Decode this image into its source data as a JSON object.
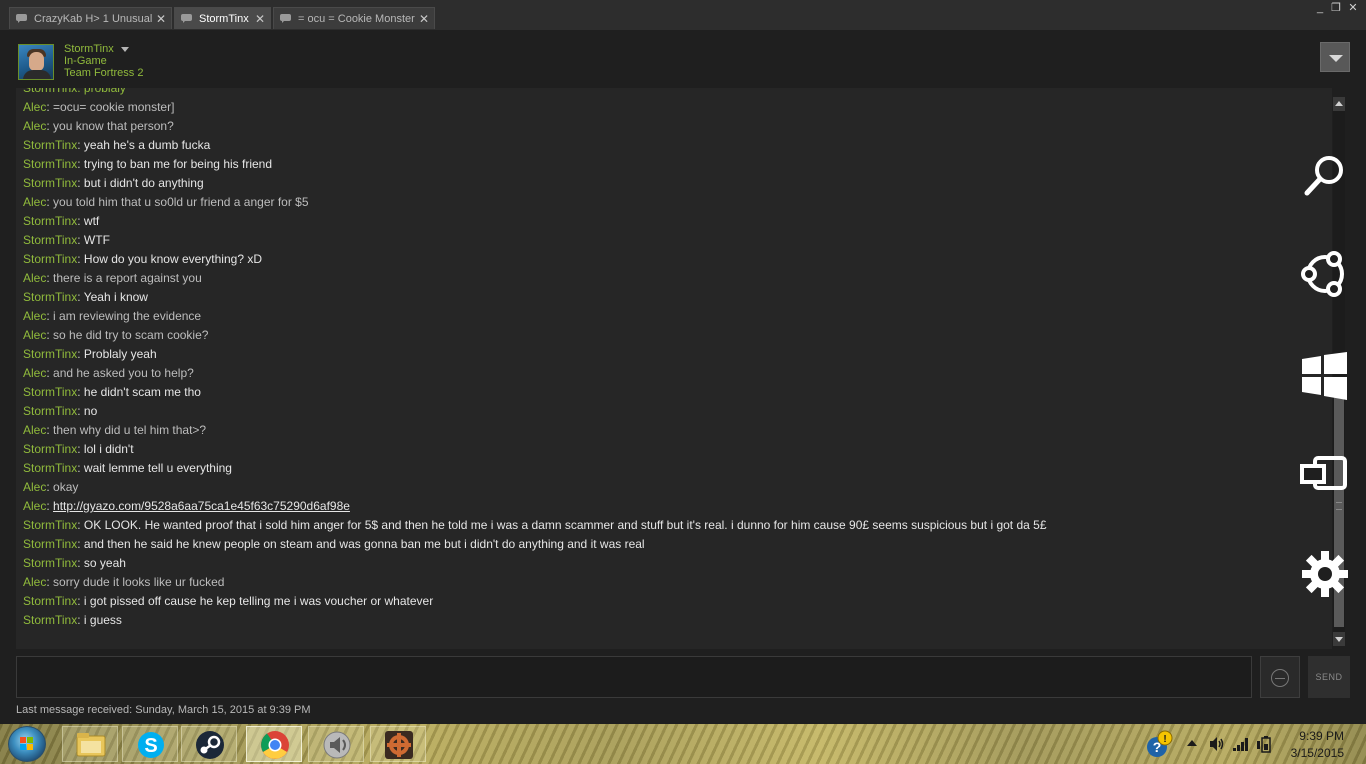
{
  "tabs": [
    {
      "label": "CrazyKab H> 1 Unusual",
      "active": false
    },
    {
      "label": "StormTinx",
      "active": true
    },
    {
      "label": "= ocu = Cookie Monster",
      "active": false
    }
  ],
  "window_controls": {
    "minimize": "_",
    "maximize": "❐"
  },
  "friend": {
    "name": "StormTinx",
    "status": "In-Game",
    "game": "Team Fortress 2"
  },
  "chat": {
    "partial_top_line": "StormTinx: problaly",
    "messages": [
      {
        "sender": "Alec",
        "text": "=ocu= cookie monster]"
      },
      {
        "sender": "Alec",
        "text": "you know that person?"
      },
      {
        "sender": "StormTinx",
        "text": "yeah he's a dumb fucka"
      },
      {
        "sender": "StormTinx",
        "text": "trying to ban me for being his friend"
      },
      {
        "sender": "StormTinx",
        "text": "but i didn't do anything"
      },
      {
        "sender": "Alec",
        "text": "you told him that u so0ld ur friend a anger for $5"
      },
      {
        "sender": "StormTinx",
        "text": "wtf"
      },
      {
        "sender": "StormTinx",
        "text": "WTF"
      },
      {
        "sender": "StormTinx",
        "text": "How do you know everything? xD"
      },
      {
        "sender": "Alec",
        "text": "there is a report against you"
      },
      {
        "sender": "StormTinx",
        "text": "Yeah i know"
      },
      {
        "sender": "Alec",
        "text": "i am reviewing the evidence"
      },
      {
        "sender": "Alec",
        "text": "so he did try to scam cookie?"
      },
      {
        "sender": "StormTinx",
        "text": "Problaly yeah"
      },
      {
        "sender": "Alec",
        "text": "and he asked you to help?"
      },
      {
        "sender": "StormTinx",
        "text": "he didn't scam me tho"
      },
      {
        "sender": "StormTinx",
        "text": "no"
      },
      {
        "sender": "Alec",
        "text": "then why did u tel him that>?"
      },
      {
        "sender": "StormTinx",
        "text": "lol i didn't"
      },
      {
        "sender": "StormTinx",
        "text": "wait lemme tell u everything"
      },
      {
        "sender": "Alec",
        "text": "okay"
      },
      {
        "sender": "Alec",
        "text": "http://gyazo.com/9528a6aa75ca1e45f63c75290d6af98e",
        "link": true
      },
      {
        "sender": "StormTinx",
        "text": "OK LOOK. He wanted proof that i sold him anger for 5$ and then he told me i was a damn scammer and stuff but it's real. i dunno for him cause 90£ seems suspicious but i got da 5£"
      },
      {
        "sender": "StormTinx",
        "text": "and then he said he knew people on steam and was gonna ban me but i didn't do anything and it was real"
      },
      {
        "sender": "StormTinx",
        "text": "so yeah"
      },
      {
        "sender": "Alec",
        "text": "sorry dude it looks like ur fucked"
      },
      {
        "sender": "StormTinx",
        "text": "i got pissed off cause he kep telling me i was voucher or whatever"
      },
      {
        "sender": "StormTinx",
        "text": "i guess"
      }
    ]
  },
  "charms": [
    "search-icon",
    "share-icon",
    "start-icon",
    "devices-icon",
    "settings-icon"
  ],
  "input": {
    "value": "",
    "placeholder": ""
  },
  "send_label": "SEND",
  "last_received": "Last message received: Sunday, March 15, 2015 at 9:39 PM",
  "taskbar": {
    "apps": [
      "file-explorer-icon",
      "skype-icon",
      "steam-icon",
      "chrome-icon",
      "speaker-app-icon",
      "tf2-icon"
    ],
    "active_app": "chrome-icon",
    "clock_time": "9:39 PM",
    "clock_date": "3/15/2015"
  },
  "colors": {
    "name_green": "#90ba3c",
    "chat_bg": "#262626",
    "window_bg": "#1f1f1f"
  }
}
